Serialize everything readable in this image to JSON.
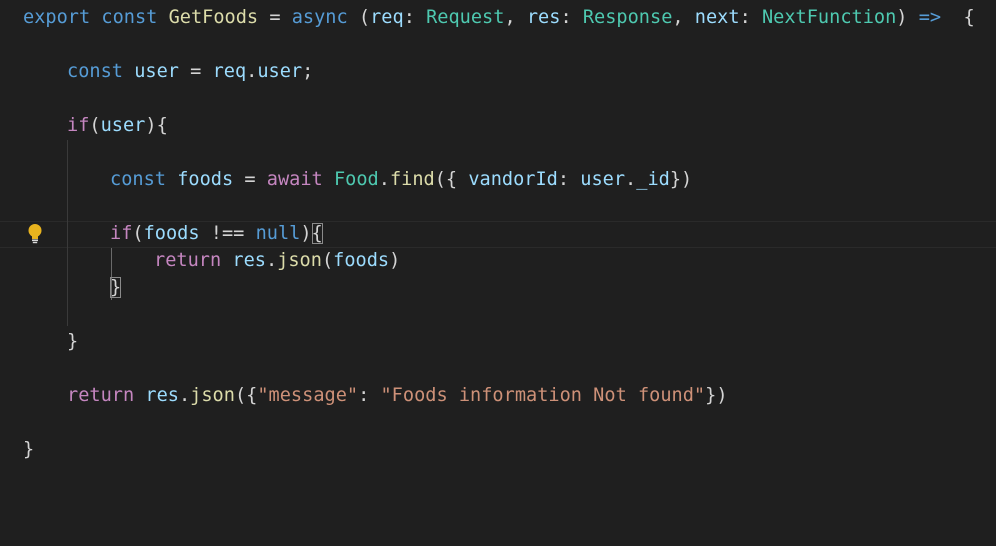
{
  "editor": {
    "language": "typescript",
    "theme_background": "#1f1f1f",
    "icons": [
      "lightbulb-icon"
    ],
    "lines": [
      [
        {
          "text": "export",
          "kind": "keyword"
        },
        {
          "text": " ",
          "kind": "punct"
        },
        {
          "text": "const",
          "kind": "keyword"
        },
        {
          "text": " ",
          "kind": "punct"
        },
        {
          "text": "GetFoods",
          "kind": "function"
        },
        {
          "text": " = ",
          "kind": "punct"
        },
        {
          "text": "async",
          "kind": "keyword"
        },
        {
          "text": " (",
          "kind": "punct"
        },
        {
          "text": "req",
          "kind": "variable"
        },
        {
          "text": ": ",
          "kind": "punct"
        },
        {
          "text": "Request",
          "kind": "type"
        },
        {
          "text": ", ",
          "kind": "punct"
        },
        {
          "text": "res",
          "kind": "variable"
        },
        {
          "text": ": ",
          "kind": "punct"
        },
        {
          "text": "Response",
          "kind": "type"
        },
        {
          "text": ", ",
          "kind": "punct"
        },
        {
          "text": "next",
          "kind": "variable"
        },
        {
          "text": ": ",
          "kind": "punct"
        },
        {
          "text": "NextFunction",
          "kind": "type"
        },
        {
          "text": ") ",
          "kind": "punct"
        },
        {
          "text": "=>",
          "kind": "keyword"
        },
        {
          "text": "  {",
          "kind": "punct"
        }
      ],
      [
        {
          "text": "const",
          "kind": "keyword"
        },
        {
          "text": " ",
          "kind": "punct"
        },
        {
          "text": "user",
          "kind": "variable"
        },
        {
          "text": " = ",
          "kind": "punct"
        },
        {
          "text": "req",
          "kind": "variable"
        },
        {
          "text": ".",
          "kind": "punct"
        },
        {
          "text": "user",
          "kind": "variable"
        },
        {
          "text": ";",
          "kind": "punct"
        }
      ],
      [
        {
          "text": "if",
          "kind": "control"
        },
        {
          "text": "(",
          "kind": "punct"
        },
        {
          "text": "user",
          "kind": "variable"
        },
        {
          "text": "){",
          "kind": "punct"
        }
      ],
      [
        {
          "text": "const",
          "kind": "keyword"
        },
        {
          "text": " ",
          "kind": "punct"
        },
        {
          "text": "foods",
          "kind": "variable"
        },
        {
          "text": " = ",
          "kind": "punct"
        },
        {
          "text": "await",
          "kind": "control"
        },
        {
          "text": " ",
          "kind": "punct"
        },
        {
          "text": "Food",
          "kind": "type"
        },
        {
          "text": ".",
          "kind": "punct"
        },
        {
          "text": "find",
          "kind": "function"
        },
        {
          "text": "({ ",
          "kind": "punct"
        },
        {
          "text": "vandorId",
          "kind": "variable"
        },
        {
          "text": ": ",
          "kind": "punct"
        },
        {
          "text": "user",
          "kind": "variable"
        },
        {
          "text": ".",
          "kind": "punct"
        },
        {
          "text": "_id",
          "kind": "variable"
        },
        {
          "text": "})",
          "kind": "punct"
        }
      ],
      [
        {
          "text": "if",
          "kind": "control"
        },
        {
          "text": "(",
          "kind": "punct"
        },
        {
          "text": "foods",
          "kind": "variable"
        },
        {
          "text": " !== ",
          "kind": "punct"
        },
        {
          "text": "null",
          "kind": "keyword"
        },
        {
          "text": ")",
          "kind": "punct"
        },
        {
          "text": "{",
          "kind": "bracket-match"
        }
      ],
      [
        {
          "text": "return",
          "kind": "control"
        },
        {
          "text": " ",
          "kind": "punct"
        },
        {
          "text": "res",
          "kind": "variable"
        },
        {
          "text": ".",
          "kind": "punct"
        },
        {
          "text": "json",
          "kind": "function"
        },
        {
          "text": "(",
          "kind": "punct"
        },
        {
          "text": "foods",
          "kind": "variable"
        },
        {
          "text": ")",
          "kind": "punct"
        }
      ],
      [
        {
          "text": "}",
          "kind": "bracket-match"
        }
      ],
      [
        {
          "text": "}",
          "kind": "punct"
        }
      ],
      [
        {
          "text": "return",
          "kind": "control"
        },
        {
          "text": " ",
          "kind": "punct"
        },
        {
          "text": "res",
          "kind": "variable"
        },
        {
          "text": ".",
          "kind": "punct"
        },
        {
          "text": "json",
          "kind": "function"
        },
        {
          "text": "({",
          "kind": "punct"
        },
        {
          "text": "\"message\"",
          "kind": "string"
        },
        {
          "text": ": ",
          "kind": "punct"
        },
        {
          "text": "\"Foods information Not found\"",
          "kind": "string"
        },
        {
          "text": "})",
          "kind": "punct"
        }
      ],
      [
        {
          "text": "}",
          "kind": "punct"
        }
      ]
    ]
  }
}
